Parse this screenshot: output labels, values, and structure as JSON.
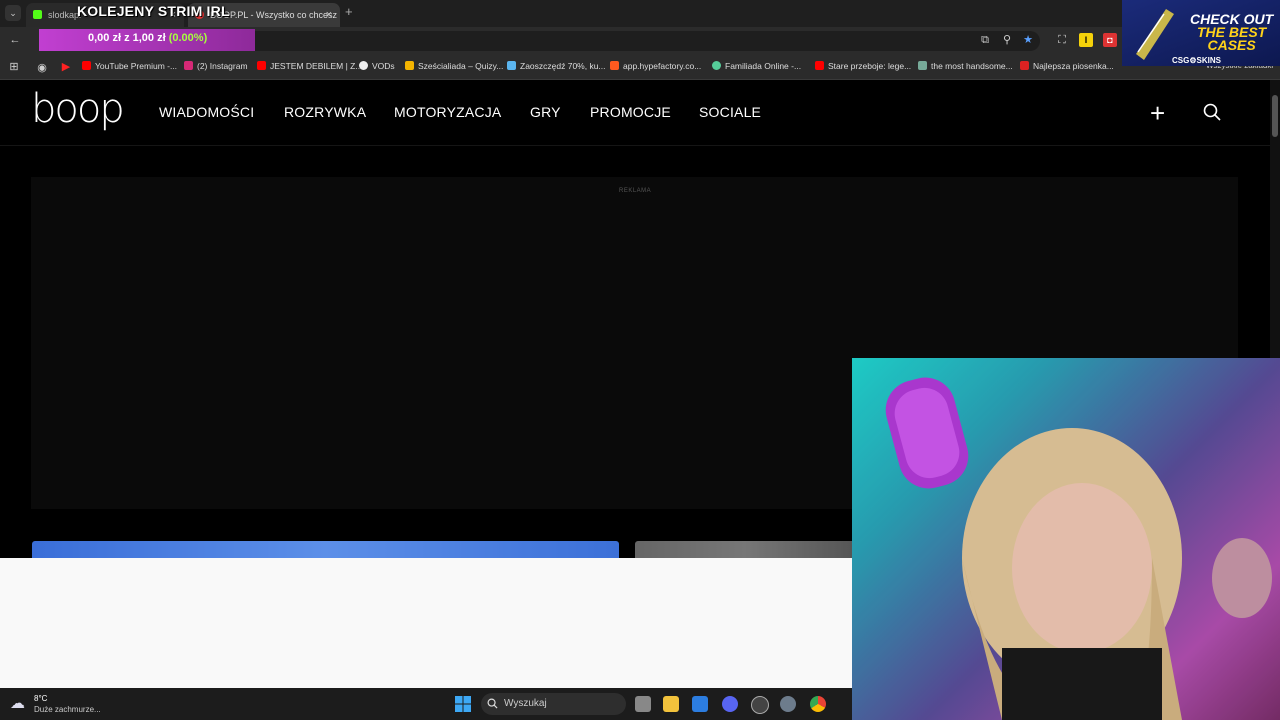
{
  "stream_overlay": {
    "title": "KOLEJENY STRIM IRL",
    "goal_amount": "0,00 zł z 1,00 zł",
    "goal_percent": "(0.00%)"
  },
  "browser": {
    "tabs": [
      {
        "label": "slodkapl",
        "close": "×"
      },
      {
        "label": "BOOP.PL - Wszystko co chcesz",
        "close": "×"
      }
    ],
    "new_tab": "+",
    "bookmarks": [
      {
        "label": "YouTube Premium -..."
      },
      {
        "label": "(2) Instagram"
      },
      {
        "label": "JESTEM DEBILEM | Z..."
      },
      {
        "label": "VODs"
      },
      {
        "label": "Sześcialiada – Quizy..."
      },
      {
        "label": "Zaoszczędź 70%, ku..."
      },
      {
        "label": "app.hypefactory.co..."
      },
      {
        "label": "Familiada Online -..."
      },
      {
        "label": "Stare przeboje: lege..."
      },
      {
        "label": "the most handsome..."
      },
      {
        "label": "Najlepsza piosenka..."
      }
    ],
    "all_bookmarks": "Wszystkie zakładki"
  },
  "site": {
    "logo": "boop",
    "nav": [
      "WIADOMOŚCI",
      "ROZRYWKA",
      "MOTORYZACJA",
      "GRY",
      "PROMOCJE",
      "SOCIALE"
    ],
    "plus": "+",
    "ad_label": "REKLAMA"
  },
  "taskbar": {
    "weather_temp": "8°C",
    "weather_desc": "Duże zachmurze...",
    "search_placeholder": "Wyszukaj"
  },
  "promo": {
    "line1": "CHECK OUT",
    "line2": "THE BEST",
    "line3": "CASES",
    "brand": "CSG⚙SKINS"
  },
  "colors": {
    "goal_bar": "#c13fd1",
    "goal_pct": "#a6ff3d",
    "background": "#000000"
  }
}
